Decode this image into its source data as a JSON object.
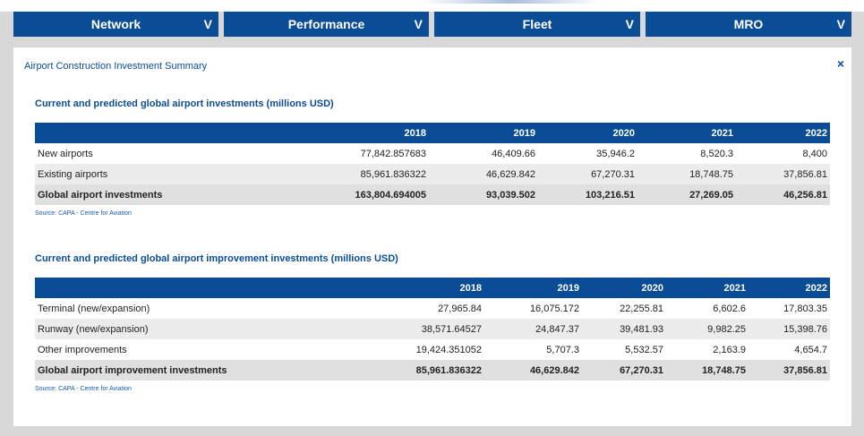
{
  "nav": {
    "tabs": [
      {
        "label": "Network",
        "chevron": "V"
      },
      {
        "label": "Performance",
        "chevron": "V"
      },
      {
        "label": "Fleet",
        "chevron": "V"
      },
      {
        "label": "MRO",
        "chevron": "V"
      }
    ]
  },
  "panel": {
    "title": "Airport Construction Investment Summary",
    "close_symbol": "×"
  },
  "table1": {
    "title": "Current and predicted global airport investments (millions USD)",
    "headers": [
      "",
      "2018",
      "2019",
      "2020",
      "2021",
      "2022"
    ],
    "rows": [
      [
        "New airports",
        "77,842.857683",
        "46,409.66",
        "35,946.2",
        "8,520.3",
        "8,400"
      ],
      [
        "Existing airports",
        "85,961.836322",
        "46,629.842",
        "67,270.31",
        "18,748.75",
        "37,856.81"
      ],
      [
        "Global airport investments",
        "163,804.694005",
        "93,039.502",
        "103,216.51",
        "27,269.05",
        "46,256.81"
      ]
    ],
    "source": "Source: CAPA - Centre for Aviation"
  },
  "table2": {
    "title": "Current and predicted global airport improvement investments (millions USD)",
    "headers": [
      "",
      "2018",
      "2019",
      "2020",
      "2021",
      "2022"
    ],
    "rows": [
      [
        "Terminal (new/expansion)",
        "27,965.84",
        "16,075.172",
        "22,255.81",
        "6,602.6",
        "17,803.35"
      ],
      [
        "Runway (new/expansion)",
        "38,571.64527",
        "24,847.37",
        "39,481.93",
        "9,982.25",
        "15,398.76"
      ],
      [
        "Other improvements",
        "19,424.351052",
        "5,707.3",
        "5,532.57",
        "2,163.9",
        "4,654.7"
      ],
      [
        "Global airport improvement investments",
        "85,961.836322",
        "46,629.842",
        "67,270.31",
        "18,748.75",
        "37,856.81"
      ]
    ],
    "source": "Source: CAPA - Centre for Aviation"
  }
}
